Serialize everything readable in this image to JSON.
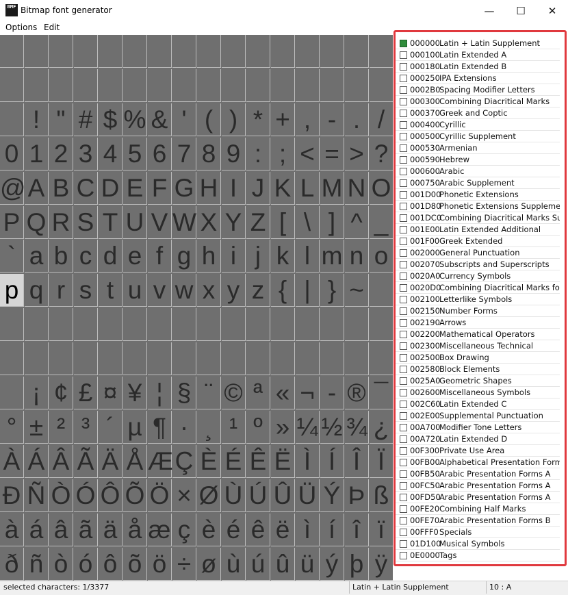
{
  "window": {
    "icon_text": "BMF",
    "title": "Bitmap font generator",
    "minimize": "—",
    "maximize": "☐",
    "close": "✕"
  },
  "menu": [
    "Options",
    "Edit"
  ],
  "grid": {
    "columns": 16,
    "rows": [
      {
        "hatch": true
      },
      {
        "hatch": true
      },
      {
        "chars": [
          " ",
          "!",
          "\"",
          "#",
          "$",
          "%",
          "&",
          "'",
          "(",
          ")",
          "*",
          "+",
          ",",
          "-",
          ".",
          "/"
        ]
      },
      {
        "chars": [
          "0",
          "1",
          "2",
          "3",
          "4",
          "5",
          "6",
          "7",
          "8",
          "9",
          ":",
          ";",
          "<",
          "=",
          ">",
          "?"
        ]
      },
      {
        "chars": [
          "@",
          "A",
          "B",
          "C",
          "D",
          "E",
          "F",
          "G",
          "H",
          "I",
          "J",
          "K",
          "L",
          "M",
          "N",
          "O"
        ]
      },
      {
        "chars": [
          "P",
          "Q",
          "R",
          "S",
          "T",
          "U",
          "V",
          "W",
          "X",
          "Y",
          "Z",
          "[",
          "\\",
          "]",
          "^",
          "_"
        ]
      },
      {
        "chars": [
          "`",
          "a",
          "b",
          "c",
          "d",
          "e",
          "f",
          "g",
          "h",
          "i",
          "j",
          "k",
          "l",
          "m",
          "n",
          "o"
        ]
      },
      {
        "chars": [
          "p",
          "q",
          "r",
          "s",
          "t",
          "u",
          "v",
          "w",
          "x",
          "y",
          "z",
          "{",
          "|",
          "}",
          "~",
          null
        ],
        "selected_index": 0
      },
      {
        "hatch": true
      },
      {
        "hatch": true
      },
      {
        "chars": [
          " ",
          "¡",
          "¢",
          "£",
          "¤",
          "¥",
          "¦",
          "§",
          "¨",
          "©",
          "ª",
          "«",
          "¬",
          "-",
          "®",
          "¯"
        ]
      },
      {
        "chars": [
          "°",
          "±",
          "²",
          "³",
          "´",
          "µ",
          "¶",
          "·",
          "¸",
          "¹",
          "º",
          "»",
          "¼",
          "½",
          "¾",
          "¿"
        ]
      },
      {
        "chars": [
          "À",
          "Á",
          "Â",
          "Ã",
          "Ä",
          "Å",
          "Æ",
          "Ç",
          "È",
          "É",
          "Ê",
          "Ë",
          "Ì",
          "Í",
          "Î",
          "Ï"
        ]
      },
      {
        "chars": [
          "Ð",
          "Ñ",
          "Ò",
          "Ó",
          "Ô",
          "Õ",
          "Ö",
          "×",
          "Ø",
          "Ù",
          "Ú",
          "Û",
          "Ü",
          "Ý",
          "Þ",
          "ß"
        ]
      },
      {
        "chars": [
          "à",
          "á",
          "â",
          "ã",
          "ä",
          "å",
          "æ",
          "ç",
          "è",
          "é",
          "ê",
          "ë",
          "ì",
          "í",
          "î",
          "ï"
        ]
      },
      {
        "chars": [
          "ð",
          "ñ",
          "ò",
          "ó",
          "ô",
          "õ",
          "ö",
          "÷",
          "ø",
          "ù",
          "ú",
          "û",
          "ü",
          "ý",
          "þ",
          "ÿ"
        ]
      }
    ]
  },
  "blocks": [
    {
      "code": "000000",
      "name": "Latin + Latin Supplement",
      "checked": true
    },
    {
      "code": "000100",
      "name": "Latin Extended A",
      "checked": false
    },
    {
      "code": "000180",
      "name": "Latin Extended B",
      "checked": false
    },
    {
      "code": "000250",
      "name": "IPA Extensions",
      "checked": false
    },
    {
      "code": "0002B0",
      "name": "Spacing Modifier Letters",
      "checked": false
    },
    {
      "code": "000300",
      "name": "Combining Diacritical Marks",
      "checked": false
    },
    {
      "code": "000370",
      "name": "Greek and Coptic",
      "checked": false
    },
    {
      "code": "000400",
      "name": "Cyrillic",
      "checked": false
    },
    {
      "code": "000500",
      "name": "Cyrillic Supplement",
      "checked": false
    },
    {
      "code": "000530",
      "name": "Armenian",
      "checked": false
    },
    {
      "code": "000590",
      "name": "Hebrew",
      "checked": false
    },
    {
      "code": "000600",
      "name": "Arabic",
      "checked": false
    },
    {
      "code": "000750",
      "name": "Arabic Supplement",
      "checked": false
    },
    {
      "code": "001D00",
      "name": "Phonetic Extensions",
      "checked": false
    },
    {
      "code": "001D80",
      "name": "Phonetic Extensions Supplement",
      "checked": false
    },
    {
      "code": "001DC0",
      "name": "Combining Diacritical Marks Sup...",
      "checked": false
    },
    {
      "code": "001E00",
      "name": "Latin Extended Additional",
      "checked": false
    },
    {
      "code": "001F00",
      "name": "Greek Extended",
      "checked": false
    },
    {
      "code": "002000",
      "name": "General Punctuation",
      "checked": false
    },
    {
      "code": "002070",
      "name": "Subscripts and Superscripts",
      "checked": false
    },
    {
      "code": "0020A0",
      "name": "Currency Symbols",
      "checked": false
    },
    {
      "code": "0020D0",
      "name": "Combining Diacritical Marks for ...",
      "checked": false
    },
    {
      "code": "002100",
      "name": "Letterlike Symbols",
      "checked": false
    },
    {
      "code": "002150",
      "name": "Number Forms",
      "checked": false
    },
    {
      "code": "002190",
      "name": "Arrows",
      "checked": false
    },
    {
      "code": "002200",
      "name": "Mathematical Operators",
      "checked": false
    },
    {
      "code": "002300",
      "name": "Miscellaneous Technical",
      "checked": false
    },
    {
      "code": "002500",
      "name": "Box Drawing",
      "checked": false
    },
    {
      "code": "002580",
      "name": "Block Elements",
      "checked": false
    },
    {
      "code": "0025A0",
      "name": "Geometric Shapes",
      "checked": false
    },
    {
      "code": "002600",
      "name": "Miscellaneous Symbols",
      "checked": false
    },
    {
      "code": "002C60",
      "name": "Latin Extended C",
      "checked": false
    },
    {
      "code": "002E00",
      "name": "Supplemental Punctuation",
      "checked": false
    },
    {
      "code": "00A700",
      "name": "Modifier Tone Letters",
      "checked": false
    },
    {
      "code": "00A720",
      "name": "Latin Extended D",
      "checked": false
    },
    {
      "code": "00F300",
      "name": "Private Use Area",
      "checked": false
    },
    {
      "code": "00FB00",
      "name": "Alphabetical Presentation Forms",
      "checked": false
    },
    {
      "code": "00FB50",
      "name": "Arabic Presentation Forms A",
      "checked": false
    },
    {
      "code": "00FC50",
      "name": "Arabic Presentation Forms A",
      "checked": false
    },
    {
      "code": "00FD50",
      "name": "Arabic Presentation Forms A",
      "checked": false
    },
    {
      "code": "00FE20",
      "name": "Combining Half Marks",
      "checked": false
    },
    {
      "code": "00FE70",
      "name": "Arabic Presentation Forms B",
      "checked": false
    },
    {
      "code": "00FFF0",
      "name": "Specials",
      "checked": false
    },
    {
      "code": "01D100",
      "name": "Musical Symbols",
      "checked": false
    },
    {
      "code": "0E0000",
      "name": "Tags",
      "checked": false
    }
  ],
  "status": {
    "selected": "selected characters: 1/3377",
    "block": "Latin + Latin Supplement",
    "position": "10 : A"
  },
  "colors": {
    "highlight_border": "#e0393e",
    "checked_box": "#2e8b3a"
  }
}
